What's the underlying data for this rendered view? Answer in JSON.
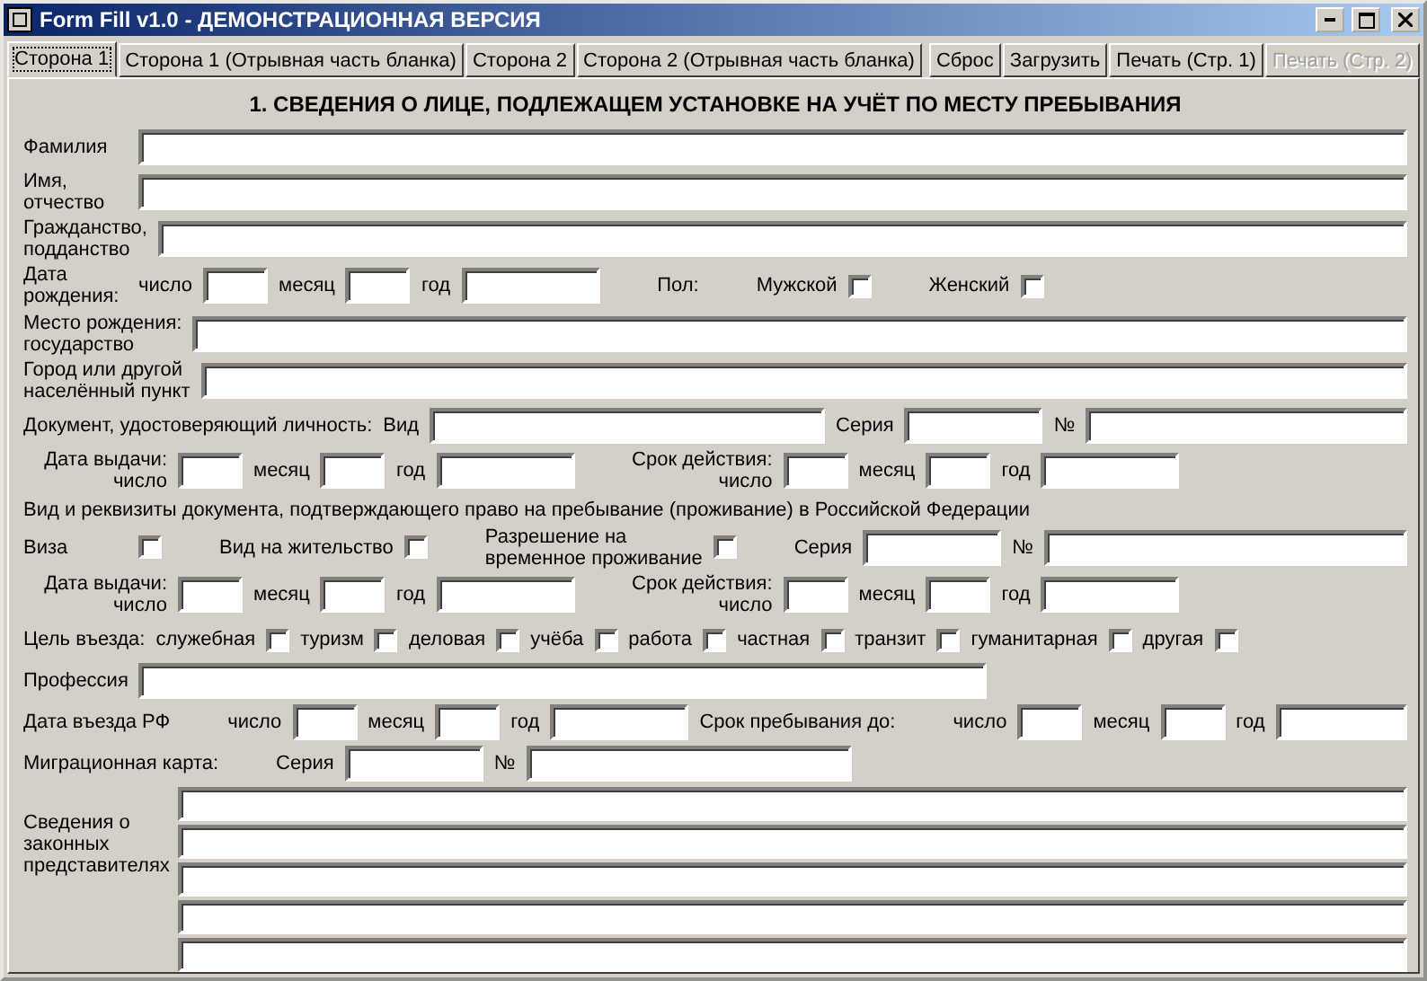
{
  "window": {
    "title": "Form Fill v1.0 - ДЕМОНСТРАЦИОННАЯ ВЕРСИЯ"
  },
  "tabs": [
    {
      "label": "Сторона 1",
      "selected": true
    },
    {
      "label": "Сторона 1 (Отрывная часть бланка)",
      "selected": false
    },
    {
      "label": "Сторона 2",
      "selected": false
    },
    {
      "label": "Сторона 2 (Отрывная часть бланка)",
      "selected": false
    }
  ],
  "buttons": [
    {
      "label": "Сброс",
      "disabled": false
    },
    {
      "label": "Загрузить",
      "disabled": false
    },
    {
      "label": "Печать (Стр. 1)",
      "disabled": false
    },
    {
      "label": "Печать (Стр. 2)",
      "disabled": true
    }
  ],
  "heading": "1. СВЕДЕНИЯ О ЛИЦЕ, ПОДЛЕЖАЩЕМ УСТАНОВКЕ НА УЧЁТ ПО МЕСТУ ПРЕБЫВАНИЯ",
  "rows": [
    {
      "kind": "line",
      "items": [
        {
          "kind": "label",
          "text": "Фамилия"
        },
        {
          "kind": "fill"
        }
      ]
    },
    {
      "kind": "line",
      "items": [
        {
          "kind": "stack",
          "lines": [
            "Имя,",
            "отчество"
          ]
        },
        {
          "kind": "fill"
        }
      ]
    },
    {
      "kind": "line",
      "items": [
        {
          "kind": "stack",
          "lines": [
            "Гражданство,",
            "подданство"
          ]
        },
        {
          "kind": "fill"
        }
      ]
    },
    {
      "kind": "line",
      "items": [
        {
          "kind": "stack",
          "lines": [
            "Дата",
            "рождения:"
          ]
        },
        {
          "kind": "label",
          "text": "число"
        },
        {
          "kind": "day"
        },
        {
          "kind": "label",
          "text": "месяц"
        },
        {
          "kind": "day"
        },
        {
          "kind": "label",
          "text": "год"
        },
        {
          "kind": "year"
        },
        {
          "kind": "far",
          "text": "Пол:"
        },
        {
          "kind": "far",
          "text": "Мужской"
        },
        {
          "kind": "check",
          "checked": false
        },
        {
          "kind": "far",
          "text": "Женский"
        },
        {
          "kind": "check",
          "checked": false
        }
      ]
    },
    {
      "kind": "line",
      "items": [
        {
          "kind": "stack",
          "lines": [
            "Место рождения:",
            "государство"
          ]
        },
        {
          "kind": "fill"
        }
      ]
    },
    {
      "kind": "line",
      "items": [
        {
          "kind": "stack",
          "lines": [
            "Город или другой",
            "населённый пункт"
          ]
        },
        {
          "kind": "fill"
        }
      ]
    },
    {
      "kind": "line",
      "items": [
        {
          "kind": "label",
          "text": "Документ, удостоверяющий личность:"
        },
        {
          "kind": "label",
          "text": "Вид"
        },
        {
          "kind": "wide"
        },
        {
          "kind": "label",
          "text": "Серия"
        },
        {
          "kind": "year"
        },
        {
          "kind": "label",
          "text": "№"
        },
        {
          "kind": "fill"
        }
      ]
    },
    {
      "kind": "line",
      "items": [
        {
          "kind": "rstack",
          "lines": [
            "Дата выдачи:",
            "число"
          ]
        },
        {
          "kind": "day"
        },
        {
          "kind": "label",
          "text": "месяц"
        },
        {
          "kind": "day"
        },
        {
          "kind": "label",
          "text": "год"
        },
        {
          "kind": "year"
        },
        {
          "kind": "rstack",
          "lines": [
            "Срок действия:",
            "число"
          ]
        },
        {
          "kind": "day"
        },
        {
          "kind": "label",
          "text": "месяц"
        },
        {
          "kind": "day"
        },
        {
          "kind": "label",
          "text": "год"
        },
        {
          "kind": "year"
        }
      ]
    },
    {
      "kind": "text",
      "text": "Вид и реквизиты документа, подтверждающего право на пребывание (проживание) в Российской Федерации"
    },
    {
      "kind": "line",
      "items": [
        {
          "kind": "label",
          "text": "Виза"
        },
        {
          "kind": "check",
          "checked": false
        },
        {
          "kind": "far",
          "text": "Вид на жительство"
        },
        {
          "kind": "check",
          "checked": false
        },
        {
          "kind": "stack",
          "lines": [
            "Разрешение на",
            "временное проживание"
          ]
        },
        {
          "kind": "check",
          "checked": false
        },
        {
          "kind": "far",
          "text": "Серия"
        },
        {
          "kind": "year"
        },
        {
          "kind": "label",
          "text": "№"
        },
        {
          "kind": "fill"
        }
      ]
    },
    {
      "kind": "line",
      "items": [
        {
          "kind": "rstack",
          "lines": [
            "Дата выдачи:",
            "число"
          ]
        },
        {
          "kind": "day"
        },
        {
          "kind": "label",
          "text": "месяц"
        },
        {
          "kind": "day"
        },
        {
          "kind": "label",
          "text": "год"
        },
        {
          "kind": "year"
        },
        {
          "kind": "rstack",
          "lines": [
            "Срок действия:",
            "число"
          ]
        },
        {
          "kind": "day"
        },
        {
          "kind": "label",
          "text": "месяц"
        },
        {
          "kind": "day"
        },
        {
          "kind": "label",
          "text": "год"
        },
        {
          "kind": "year"
        }
      ]
    },
    {
      "kind": "line",
      "items": [
        {
          "kind": "label",
          "text": "Цель въезда:"
        },
        {
          "kind": "label",
          "text": "служебная"
        },
        {
          "kind": "check",
          "checked": false
        },
        {
          "kind": "label",
          "text": "туризм"
        },
        {
          "kind": "check",
          "checked": false
        },
        {
          "kind": "label",
          "text": "деловая"
        },
        {
          "kind": "check",
          "checked": false
        },
        {
          "kind": "label",
          "text": "учёба"
        },
        {
          "kind": "check",
          "checked": false
        },
        {
          "kind": "label",
          "text": "работа"
        },
        {
          "kind": "check",
          "checked": false
        },
        {
          "kind": "label",
          "text": "частная"
        },
        {
          "kind": "check",
          "checked": false
        },
        {
          "kind": "label",
          "text": "транзит"
        },
        {
          "kind": "check",
          "checked": false
        },
        {
          "kind": "label",
          "text": "гуманитарная"
        },
        {
          "kind": "check",
          "checked": false
        },
        {
          "kind": "label",
          "text": "другая"
        },
        {
          "kind": "check",
          "checked": false
        }
      ]
    },
    {
      "kind": "line",
      "items": [
        {
          "kind": "label",
          "text": "Профессия"
        },
        {
          "kind": "prof"
        }
      ]
    },
    {
      "kind": "line",
      "items": [
        {
          "kind": "label",
          "text": "Дата въезда  РФ"
        },
        {
          "kind": "far",
          "text": "число"
        },
        {
          "kind": "day"
        },
        {
          "kind": "label",
          "text": "месяц"
        },
        {
          "kind": "day"
        },
        {
          "kind": "label",
          "text": "год"
        },
        {
          "kind": "year"
        },
        {
          "kind": "label",
          "text": "Срок пребывания до:"
        },
        {
          "kind": "far",
          "text": "число"
        },
        {
          "kind": "day"
        },
        {
          "kind": "label",
          "text": "месяц"
        },
        {
          "kind": "day"
        },
        {
          "kind": "label",
          "text": "год"
        },
        {
          "kind": "fill"
        }
      ]
    },
    {
      "kind": "line",
      "items": [
        {
          "kind": "label",
          "text": "Миграционная карта:"
        },
        {
          "kind": "far",
          "text": "Серия"
        },
        {
          "kind": "year"
        },
        {
          "kind": "label",
          "text": "№"
        },
        {
          "kind": "mig"
        }
      ]
    },
    {
      "kind": "group",
      "label": [
        "Сведения о",
        "законных",
        "представителях"
      ],
      "fields": [
        {
          "kind": "fill"
        },
        {
          "kind": "fill"
        },
        {
          "kind": "fill"
        },
        {
          "kind": "fill"
        },
        {
          "kind": "fill"
        }
      ]
    }
  ]
}
